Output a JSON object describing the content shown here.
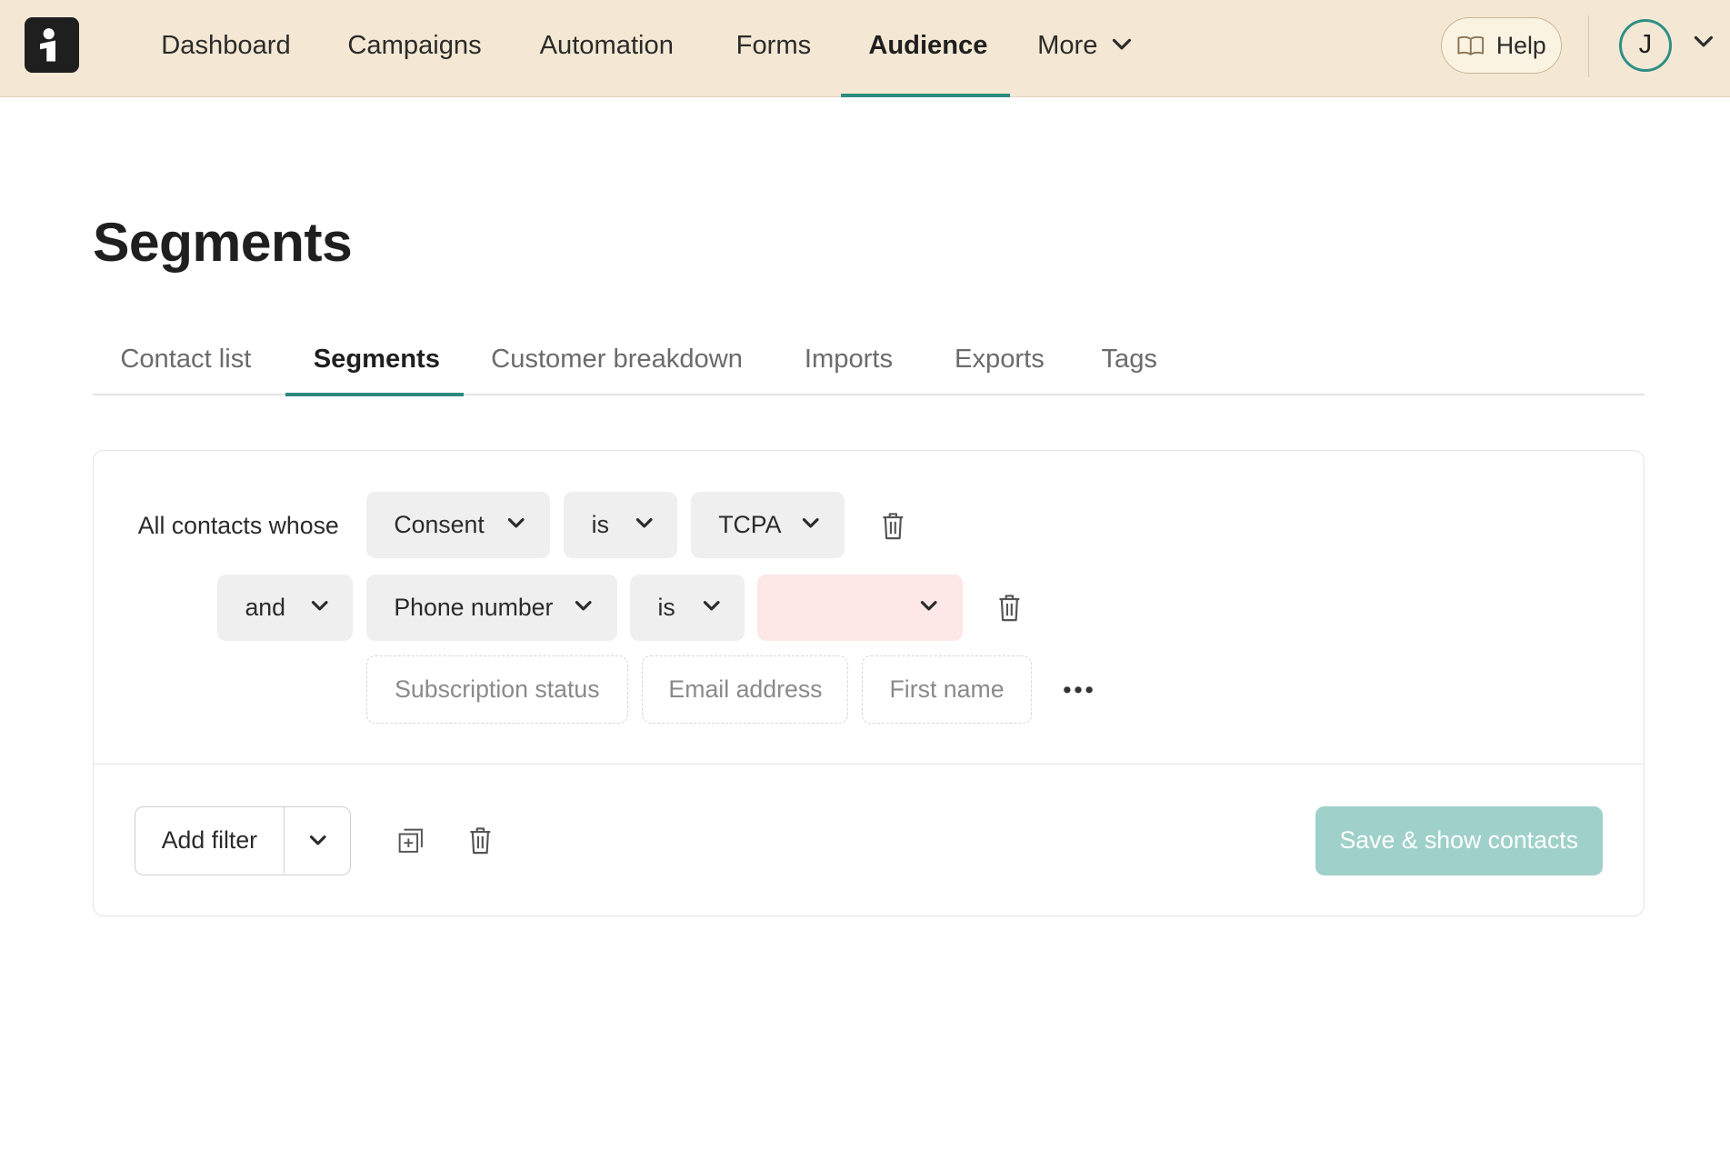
{
  "nav": {
    "logo": "brand-logo",
    "items": [
      {
        "label": "Dashboard",
        "active": false
      },
      {
        "label": "Campaigns",
        "active": false
      },
      {
        "label": "Automation",
        "active": false
      },
      {
        "label": "Forms",
        "active": false
      },
      {
        "label": "Audience",
        "active": true
      },
      {
        "label": "More",
        "active": false
      }
    ],
    "help_label": "Help",
    "avatar_initial": "J",
    "accent_color": "#2c8a80"
  },
  "page": {
    "title": "Segments"
  },
  "tabs": [
    {
      "label": "Contact list",
      "active": false
    },
    {
      "label": "Segments",
      "active": true
    },
    {
      "label": "Customer breakdown",
      "active": false
    },
    {
      "label": "Imports",
      "active": false
    },
    {
      "label": "Exports",
      "active": false
    },
    {
      "label": "Tags",
      "active": false
    }
  ],
  "filter": {
    "intro": "All contacts whose",
    "rows": [
      {
        "field": "Consent",
        "operator": "is",
        "value": "TCPA"
      },
      {
        "conjunction": "and",
        "field": "Phone number",
        "operator": "is",
        "value": ""
      }
    ],
    "suggestions": [
      "Subscription status",
      "Email address",
      "First name"
    ],
    "more_icon": "ellipsis-icon"
  },
  "footer": {
    "add_filter_label": "Add filter",
    "save_label": "Save & show contacts",
    "save_color": "#9fd0ca"
  }
}
